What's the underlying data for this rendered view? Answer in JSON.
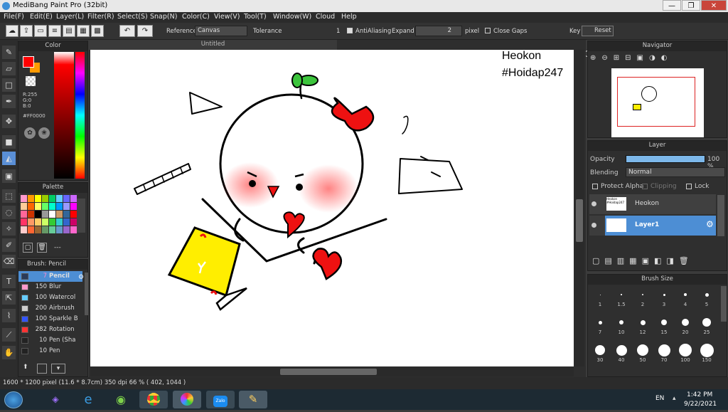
{
  "window": {
    "title": "MediBang Paint Pro (32bit)",
    "minimize": "—",
    "restore": "❐",
    "close": "✕"
  },
  "menu": [
    "File(F)",
    "Edit(E)",
    "Layer(L)",
    "Filter(R)",
    "Select(S)",
    "Snap(N)",
    "Color(C)",
    "View(V)",
    "Tool(T)",
    "Window(W)",
    "Cloud",
    "Help"
  ],
  "toolbar": {
    "reference_label": "Reference",
    "reference_value": "Canvas",
    "tolerance_label": "Tolerance",
    "tolerance_value": "1",
    "antialias_label": "AntiAliasing",
    "expand_label": "Expand",
    "expand_value": "2",
    "expand_unit": "pixel",
    "close_gaps_label": "Close Gaps",
    "key_label": "Key",
    "reset_label": "Reset"
  },
  "color_panel": {
    "title": "Color",
    "r": "R:255",
    "g": "G:0",
    "b": "B:0",
    "hex": "#FF0000",
    "primary": "#ff0000",
    "secondary": "#ff9a00"
  },
  "palette_panel": {
    "title": "Palette",
    "more": "---",
    "swatches": [
      "#ff99cc",
      "#ff9900",
      "#ffff00",
      "#99cc00",
      "#00cc66",
      "#66ccff",
      "#6666ff",
      "#cc66ff",
      "#ffcc99",
      "#ff6600",
      "#ffff66",
      "#66ff66",
      "#00ffcc",
      "#0099ff",
      "#9999ff",
      "#ff00ff",
      "#ff6699",
      "#cc3300",
      "#000000",
      "#999999",
      "#ffffff",
      "#cc9966",
      "#336699",
      "#ff0000",
      "#ff3366",
      "#ff9966",
      "#ffcc66",
      "#ccff66",
      "#33cc33",
      "#33cccc",
      "#3366cc",
      "#cc0066",
      "#ffcccc",
      "#ff6633",
      "#996633",
      "#669966",
      "#66cc99",
      "#6699cc",
      "#9966cc",
      "#ff66cc"
    ]
  },
  "brush_panel": {
    "title": "Brush: Pencil",
    "items": [
      {
        "size": "7",
        "name": "Pencil",
        "color": "#2a3a5a"
      },
      {
        "size": "150",
        "name": "Blur",
        "color": "#ff99cc"
      },
      {
        "size": "100",
        "name": "Watercol",
        "color": "#66ccff"
      },
      {
        "size": "200",
        "name": "Airbrush",
        "color": "#cccccc"
      },
      {
        "size": "100",
        "name": "Sparkle B",
        "color": "#3355ff"
      },
      {
        "size": "282",
        "name": "Rotation",
        "color": "#ff3333"
      },
      {
        "size": "10",
        "name": "Pen (Sha",
        "color": "#222222"
      },
      {
        "size": "10",
        "name": "Pen",
        "color": "#222222"
      }
    ]
  },
  "canvas": {
    "tab": "Untitled",
    "text1": "Heokon",
    "text2": "#Hoidap247"
  },
  "navigator": {
    "title": "Navigator"
  },
  "layer_panel": {
    "title": "Layer",
    "opacity_label": "Opacity",
    "opacity_value": "100 %",
    "opacity_level": 1.0,
    "blending_label": "Blending",
    "blending_value": "Normal",
    "protect_alpha": "Protect Alpha",
    "clipping": "Clipping",
    "lock": "Lock",
    "layers": [
      {
        "name": "Heokon",
        "thumb": "Heokon #Hoidap247"
      },
      {
        "name": "Layer1"
      }
    ]
  },
  "brush_size": {
    "title": "Brush Size",
    "sizes": [
      "1",
      "1.5",
      "2",
      "3",
      "4",
      "5",
      "7",
      "10",
      "12",
      "15",
      "20",
      "25",
      "30",
      "40",
      "50",
      "70",
      "100",
      "150"
    ]
  },
  "status": "1600 * 1200 pixel   (11.6 * 8.7cm)   350 dpi   66 %   ( 402, 1044 )",
  "taskbar": {
    "lang": "EN",
    "time": "1:42 PM",
    "date": "9/22/2021",
    "zalo": "Zalo"
  }
}
